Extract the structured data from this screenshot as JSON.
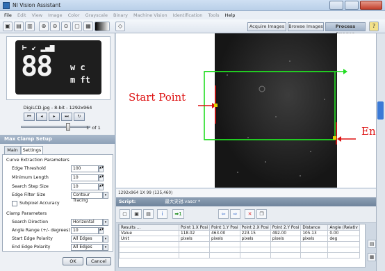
{
  "window": {
    "title": "NI Vision Assistant"
  },
  "menu": [
    "File",
    "Edit",
    "View",
    "Image",
    "Color",
    "Grayscale",
    "Binary",
    "Machine Vision",
    "Identification",
    "Tools",
    "Help"
  ],
  "modes": {
    "acquire": "Acquire Images",
    "browse": "Browse Images",
    "process": "Process Images"
  },
  "thumbnail": {
    "display_top": "⊢ ↙ ▂▄▆",
    "display_digits": "88",
    "display_unit_top": "w c",
    "display_unit_bottom": "m ft",
    "caption": "DigiLCD.jpg - 8-bit - 1292x964",
    "page_current": "1",
    "page_of": "of",
    "page_total": "1"
  },
  "panel": {
    "title": "Max Clamp Setup",
    "tabs": [
      "Main",
      "Settings"
    ],
    "curve_group": "Curve Extraction Parameters",
    "edge_threshold_label": "Edge Threshold",
    "edge_threshold": "100",
    "min_length_label": "Minimum Length",
    "min_length": "10",
    "search_step_label": "Search Step Size",
    "search_step": "10",
    "edge_filter_label": "Edge Filter Size",
    "edge_filter": "Contour Tracing",
    "subpixel_label": "Subpixel Accuracy",
    "clamp_group": "Clamp Parameters",
    "search_dir_label": "Search Direction",
    "search_dir": "Horizontal",
    "angle_range_label": "Angle Range (+/- degrees)",
    "angle_range": "10",
    "start_pol_label": "Start Edge Polarity",
    "start_pol": "All Edges",
    "end_pol_label": "End Edge Polarity",
    "end_pol": "All Edges",
    "ok": "OK",
    "cancel": "Cancel"
  },
  "image": {
    "start_label": "Start Point",
    "end_label": "En",
    "status": "1292x964 1X 99      (135,460)"
  },
  "script": {
    "title": "最大夹钳.vascr *"
  },
  "results": {
    "headers": [
      "Results ...",
      "Point 1.X Posi",
      "Point 1.Y Posi",
      "Point 2.X Posi",
      "Point 2.Y Posi",
      "Distance",
      "Angle (Relativ"
    ],
    "rows": [
      [
        "Value",
        "118.02",
        "463.00",
        "223.15",
        "492.00",
        "105.13",
        "0.00"
      ],
      [
        "Unit",
        "pixels",
        "pixels",
        "pixels",
        "pixels",
        "pixels",
        "deg"
      ],
      [
        "",
        "",
        "",
        "",
        "",
        "",
        ""
      ],
      [
        "",
        "",
        "",
        "",
        "",
        "",
        ""
      ],
      [
        "",
        "",
        "",
        "",
        "",
        "",
        ""
      ]
    ]
  },
  "colors": {
    "roi": "#22dd22",
    "point": "#dd1111"
  }
}
